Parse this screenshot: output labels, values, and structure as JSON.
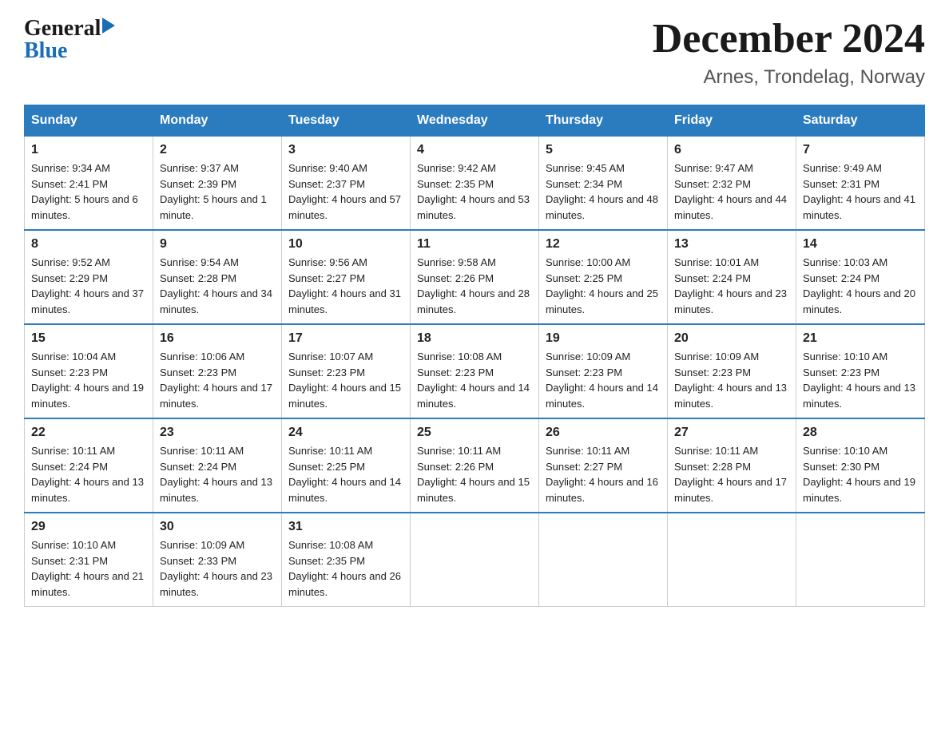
{
  "header": {
    "logo_general": "General",
    "logo_blue": "Blue",
    "title": "December 2024",
    "subtitle": "Arnes, Trondelag, Norway"
  },
  "days_of_week": [
    "Sunday",
    "Monday",
    "Tuesday",
    "Wednesday",
    "Thursday",
    "Friday",
    "Saturday"
  ],
  "weeks": [
    [
      {
        "num": "1",
        "sunrise": "9:34 AM",
        "sunset": "2:41 PM",
        "daylight": "5 hours and 6 minutes."
      },
      {
        "num": "2",
        "sunrise": "9:37 AM",
        "sunset": "2:39 PM",
        "daylight": "5 hours and 1 minute."
      },
      {
        "num": "3",
        "sunrise": "9:40 AM",
        "sunset": "2:37 PM",
        "daylight": "4 hours and 57 minutes."
      },
      {
        "num": "4",
        "sunrise": "9:42 AM",
        "sunset": "2:35 PM",
        "daylight": "4 hours and 53 minutes."
      },
      {
        "num": "5",
        "sunrise": "9:45 AM",
        "sunset": "2:34 PM",
        "daylight": "4 hours and 48 minutes."
      },
      {
        "num": "6",
        "sunrise": "9:47 AM",
        "sunset": "2:32 PM",
        "daylight": "4 hours and 44 minutes."
      },
      {
        "num": "7",
        "sunrise": "9:49 AM",
        "sunset": "2:31 PM",
        "daylight": "4 hours and 41 minutes."
      }
    ],
    [
      {
        "num": "8",
        "sunrise": "9:52 AM",
        "sunset": "2:29 PM",
        "daylight": "4 hours and 37 minutes."
      },
      {
        "num": "9",
        "sunrise": "9:54 AM",
        "sunset": "2:28 PM",
        "daylight": "4 hours and 34 minutes."
      },
      {
        "num": "10",
        "sunrise": "9:56 AM",
        "sunset": "2:27 PM",
        "daylight": "4 hours and 31 minutes."
      },
      {
        "num": "11",
        "sunrise": "9:58 AM",
        "sunset": "2:26 PM",
        "daylight": "4 hours and 28 minutes."
      },
      {
        "num": "12",
        "sunrise": "10:00 AM",
        "sunset": "2:25 PM",
        "daylight": "4 hours and 25 minutes."
      },
      {
        "num": "13",
        "sunrise": "10:01 AM",
        "sunset": "2:24 PM",
        "daylight": "4 hours and 23 minutes."
      },
      {
        "num": "14",
        "sunrise": "10:03 AM",
        "sunset": "2:24 PM",
        "daylight": "4 hours and 20 minutes."
      }
    ],
    [
      {
        "num": "15",
        "sunrise": "10:04 AM",
        "sunset": "2:23 PM",
        "daylight": "4 hours and 19 minutes."
      },
      {
        "num": "16",
        "sunrise": "10:06 AM",
        "sunset": "2:23 PM",
        "daylight": "4 hours and 17 minutes."
      },
      {
        "num": "17",
        "sunrise": "10:07 AM",
        "sunset": "2:23 PM",
        "daylight": "4 hours and 15 minutes."
      },
      {
        "num": "18",
        "sunrise": "10:08 AM",
        "sunset": "2:23 PM",
        "daylight": "4 hours and 14 minutes."
      },
      {
        "num": "19",
        "sunrise": "10:09 AM",
        "sunset": "2:23 PM",
        "daylight": "4 hours and 14 minutes."
      },
      {
        "num": "20",
        "sunrise": "10:09 AM",
        "sunset": "2:23 PM",
        "daylight": "4 hours and 13 minutes."
      },
      {
        "num": "21",
        "sunrise": "10:10 AM",
        "sunset": "2:23 PM",
        "daylight": "4 hours and 13 minutes."
      }
    ],
    [
      {
        "num": "22",
        "sunrise": "10:11 AM",
        "sunset": "2:24 PM",
        "daylight": "4 hours and 13 minutes."
      },
      {
        "num": "23",
        "sunrise": "10:11 AM",
        "sunset": "2:24 PM",
        "daylight": "4 hours and 13 minutes."
      },
      {
        "num": "24",
        "sunrise": "10:11 AM",
        "sunset": "2:25 PM",
        "daylight": "4 hours and 14 minutes."
      },
      {
        "num": "25",
        "sunrise": "10:11 AM",
        "sunset": "2:26 PM",
        "daylight": "4 hours and 15 minutes."
      },
      {
        "num": "26",
        "sunrise": "10:11 AM",
        "sunset": "2:27 PM",
        "daylight": "4 hours and 16 minutes."
      },
      {
        "num": "27",
        "sunrise": "10:11 AM",
        "sunset": "2:28 PM",
        "daylight": "4 hours and 17 minutes."
      },
      {
        "num": "28",
        "sunrise": "10:10 AM",
        "sunset": "2:30 PM",
        "daylight": "4 hours and 19 minutes."
      }
    ],
    [
      {
        "num": "29",
        "sunrise": "10:10 AM",
        "sunset": "2:31 PM",
        "daylight": "4 hours and 21 minutes."
      },
      {
        "num": "30",
        "sunrise": "10:09 AM",
        "sunset": "2:33 PM",
        "daylight": "4 hours and 23 minutes."
      },
      {
        "num": "31",
        "sunrise": "10:08 AM",
        "sunset": "2:35 PM",
        "daylight": "4 hours and 26 minutes."
      },
      null,
      null,
      null,
      null
    ]
  ],
  "labels": {
    "sunrise": "Sunrise:",
    "sunset": "Sunset:",
    "daylight": "Daylight:"
  }
}
